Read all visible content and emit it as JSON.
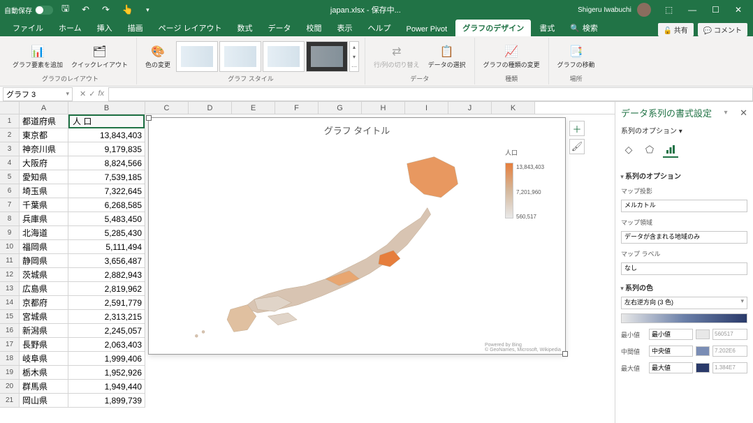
{
  "titlebar": {
    "autosave_label": "自動保存",
    "filename": "japan.xlsx - 保存中...",
    "username": "Shigeru Iwabuchi"
  },
  "tabs": {
    "file": "ファイル",
    "home": "ホーム",
    "insert": "挿入",
    "draw": "描画",
    "pagelayout": "ページ レイアウト",
    "formulas": "数式",
    "data": "データ",
    "review": "校閲",
    "view": "表示",
    "help": "ヘルプ",
    "powerpivot": "Power Pivot",
    "chartdesign": "グラフのデザイン",
    "format": "書式",
    "search_placeholder": "検索",
    "share": "共有",
    "comments": "コメント"
  },
  "ribbon": {
    "add_element": "グラフ要素を追加",
    "quick_layout": "クイックレイアウト",
    "change_colors": "色の変更",
    "layouts_group": "グラフのレイアウト",
    "styles_group": "グラフ スタイル",
    "switch_rowcol": "行/列の切り替え",
    "select_data": "データの選択",
    "data_group": "データ",
    "change_type": "グラフの種類の変更",
    "type_group": "種類",
    "move_chart": "グラフの移動",
    "location_group": "場所"
  },
  "namebox": "グラフ 3",
  "columns": [
    "A",
    "B",
    "C",
    "D",
    "E",
    "F",
    "G",
    "H",
    "I",
    "J",
    "K"
  ],
  "headers": {
    "prefecture": "都道府県",
    "population": "人 口"
  },
  "data_rows": [
    {
      "prefecture": "東京都",
      "population": "13,843,403"
    },
    {
      "prefecture": "神奈川県",
      "population": "9,179,835"
    },
    {
      "prefecture": "大阪府",
      "population": "8,824,566"
    },
    {
      "prefecture": "愛知県",
      "population": "7,539,185"
    },
    {
      "prefecture": "埼玉県",
      "population": "7,322,645"
    },
    {
      "prefecture": "千葉県",
      "population": "6,268,585"
    },
    {
      "prefecture": "兵庫県",
      "population": "5,483,450"
    },
    {
      "prefecture": "北海道",
      "population": "5,285,430"
    },
    {
      "prefecture": "福岡県",
      "population": "5,111,494"
    },
    {
      "prefecture": "静岡県",
      "population": "3,656,487"
    },
    {
      "prefecture": "茨城県",
      "population": "2,882,943"
    },
    {
      "prefecture": "広島県",
      "population": "2,819,962"
    },
    {
      "prefecture": "京都府",
      "population": "2,591,779"
    },
    {
      "prefecture": "宮城県",
      "population": "2,313,215"
    },
    {
      "prefecture": "新潟県",
      "population": "2,245,057"
    },
    {
      "prefecture": "長野県",
      "population": "2,063,403"
    },
    {
      "prefecture": "岐阜県",
      "population": "1,999,406"
    },
    {
      "prefecture": "栃木県",
      "population": "1,952,926"
    },
    {
      "prefecture": "群馬県",
      "population": "1,949,440"
    },
    {
      "prefecture": "岡山県",
      "population": "1,899,739"
    }
  ],
  "chart": {
    "title": "グラフ タイトル",
    "legend_title": "人口",
    "legend_max": "13,843,403",
    "legend_mid": "7,201,960",
    "legend_min": "560,517",
    "credit_powered": "Powered by Bing",
    "credit_sources": "© GeoNames, Microsoft, Wikipedia"
  },
  "chart_data": {
    "type": "map",
    "region": "Japan",
    "title": "グラフ タイトル",
    "color_scale": {
      "min": 560517,
      "mid": 7201960,
      "max": 13843403
    },
    "series": [
      {
        "name": "人口",
        "data": [
          {
            "region": "東京都",
            "value": 13843403
          },
          {
            "region": "神奈川県",
            "value": 9179835
          },
          {
            "region": "大阪府",
            "value": 8824566
          },
          {
            "region": "愛知県",
            "value": 7539185
          },
          {
            "region": "埼玉県",
            "value": 7322645
          },
          {
            "region": "千葉県",
            "value": 6268585
          },
          {
            "region": "兵庫県",
            "value": 5483450
          },
          {
            "region": "北海道",
            "value": 5285430
          },
          {
            "region": "福岡県",
            "value": 5111494
          },
          {
            "region": "静岡県",
            "value": 3656487
          },
          {
            "region": "茨城県",
            "value": 2882943
          },
          {
            "region": "広島県",
            "value": 2819962
          },
          {
            "region": "京都府",
            "value": 2591779
          },
          {
            "region": "宮城県",
            "value": 2313215
          },
          {
            "region": "新潟県",
            "value": 2245057
          },
          {
            "region": "長野県",
            "value": 2063403
          },
          {
            "region": "岐阜県",
            "value": 1999406
          },
          {
            "region": "栃木県",
            "value": 1952926
          },
          {
            "region": "群馬県",
            "value": 1949440
          },
          {
            "region": "岡山県",
            "value": 1899739
          }
        ]
      }
    ]
  },
  "format_pane": {
    "title": "データ系列の書式設定",
    "options_label": "系列のオプション",
    "series_options": "系列のオプション",
    "map_projection": "マップ投影",
    "map_projection_val": "メルカトル",
    "map_area": "マップ領域",
    "map_area_val": "データが含まれる地域のみ",
    "map_labels": "マップ ラベル",
    "map_labels_val": "なし",
    "series_color": "系列の色",
    "color_scheme": "左右逆方向 (3 色)",
    "min_label": "最小値",
    "min_sel": "最小値",
    "min_val": "560517",
    "mid_label": "中間値",
    "mid_sel": "中央値",
    "mid_val": "7.202E6",
    "max_label": "最大値",
    "max_sel": "最大値",
    "max_val": "1.384E7"
  }
}
